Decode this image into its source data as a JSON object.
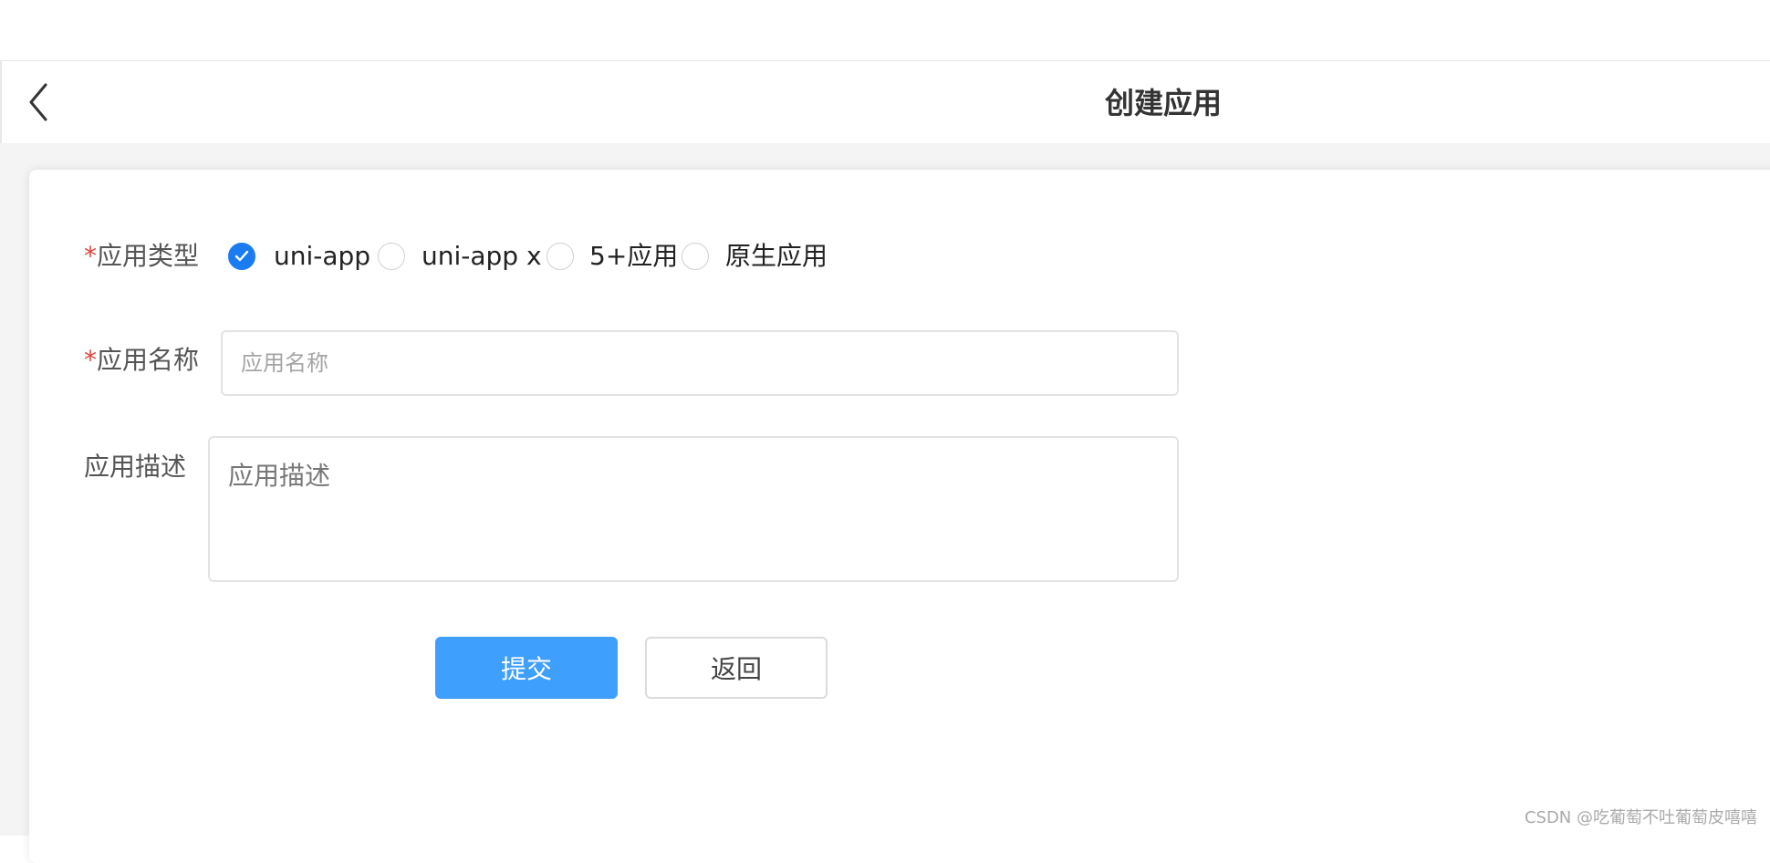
{
  "header": {
    "title": "创建应用"
  },
  "form": {
    "app_type_label": "应用类型",
    "app_type_required_mark": "*",
    "app_type_options": [
      "uni-app",
      "uni-app x",
      "5+应用",
      "原生应用"
    ],
    "app_type_selected": "uni-app",
    "app_name_label": "应用名称",
    "app_name_required_mark": "*",
    "app_name_placeholder": "应用名称",
    "app_name_value": "",
    "app_desc_label": "应用描述",
    "app_desc_placeholder": "应用描述",
    "app_desc_value": ""
  },
  "buttons": {
    "submit_label": "提交",
    "back_label": "返回"
  },
  "watermark": "CSDN @吃葡萄不吐葡萄皮嘻嘻",
  "colors": {
    "accent": "#1a7cf0",
    "submit_button": "#3f9ffc",
    "required": "#e0453b"
  },
  "icons": {
    "back": "chevron-left-icon",
    "check": "checkmark-icon"
  }
}
